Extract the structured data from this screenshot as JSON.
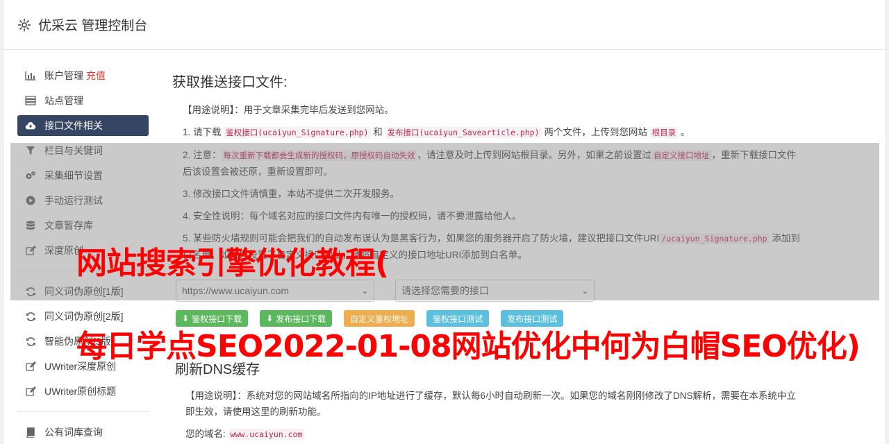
{
  "header": {
    "title": "优采云 管理控制台",
    "icon": "gear-icon"
  },
  "sidebar": {
    "items": [
      {
        "label": "账户管理",
        "extra": "充值",
        "icon": "bar-chart-icon"
      },
      {
        "label": "站点管理",
        "icon": "server-icon"
      },
      {
        "label": "接口文件相关",
        "icon": "cloud-upload-icon"
      },
      {
        "label": "栏目与关键词",
        "icon": "filter-icon"
      },
      {
        "label": "采集细节设置",
        "icon": "cogs-icon"
      },
      {
        "label": "手动运行测试",
        "icon": "play-circle-icon"
      },
      {
        "label": "文章暂存库",
        "icon": "database-icon"
      },
      {
        "label": "深度原创",
        "icon": "edit-icon"
      },
      {
        "label": "同义词伪原创[1版]",
        "icon": "refresh-icon"
      },
      {
        "label": "同义词伪原创[2版]",
        "icon": "refresh-icon"
      },
      {
        "label": "智能伪原创[3版]",
        "icon": "refresh-icon"
      },
      {
        "label": "UWriter深度原创",
        "icon": "edit-icon"
      },
      {
        "label": "UWriter原创标题",
        "icon": "edit-icon"
      },
      {
        "label": "公有词库查询",
        "icon": "book-icon"
      }
    ]
  },
  "main": {
    "title": "获取推送接口文件:",
    "usage_label": "【用途说明】",
    "usage_text": "：用于文章采集完毕后发送到您网站。",
    "s1_a": "1. 请下载 ",
    "s1_code1": "鉴权接口(ucaiyun_Signature.php)",
    "s1_b": " 和 ",
    "s1_code2": "发布接口(ucaiyun_Savearticle.php)",
    "s1_c": " 两个文件，上传到您网站 ",
    "s1_code3": "根目录",
    "s1_d": " 。",
    "s2_a": "2. 注意：",
    "s2_code1": "每次重新下载都会生成新的授权码，原授权码自动失效",
    "s2_b": "，请注意及时上传到网站根目录。另外，如果之前设置过",
    "s2_code2": "自定义接口地址",
    "s2_c": "，重新下载接口文件后该设置会被还原，重新设置即可。",
    "s3": "3. 修改接口文件请慎重，本站不提供二次开发服务。",
    "s4": "4. 安全性说明：每个域名对应的接口文件内有唯一的授权码，请不要泄露给他人。",
    "s5_a": "5. 某些防火墙规则可能会把我们的自动发布误认为是黑客行为，如果您的服务器开启了防火墙，建议把接口文件URI",
    "s5_code": "/ucaiyun_Signature.php",
    "s5_b": " 添加到白名单，如果您设置了自定义接口地址，请将自定义的接口地址URI添加到白名单。",
    "select_site": "https://www.ucaiyun.com",
    "select_api": "请选择您需要的接口",
    "buttons": {
      "download_sign": "鉴权接口下载",
      "download_publish": "发布接口下载",
      "custom_sign_url": "自定义鉴权地址",
      "test_sign": "鉴权接口测试",
      "test_publish": "发布接口测试"
    }
  },
  "dns": {
    "title": "刷新DNS缓存",
    "usage_label": "【用途说明】",
    "usage_text": "：系统对您的网站域名所指向的IP地址进行了缓存，默认每6小时自动刷新一次。如果您的域名刚刚修改了DNS解析，需要在本系统中立即生效，请使用这里的刷新功能。",
    "domain_label": "您的域名:",
    "domain_value": "www.ucaiyun.com"
  },
  "watermark": {
    "line1": "网站搜索引擎优化教程(",
    "line2": "每日学点SEO2022-01-08网站优化中何为白帽SEO优化)"
  },
  "colors": {
    "active_nav": "#364563",
    "watermark": "#ff0000",
    "code": "#c7254e"
  }
}
